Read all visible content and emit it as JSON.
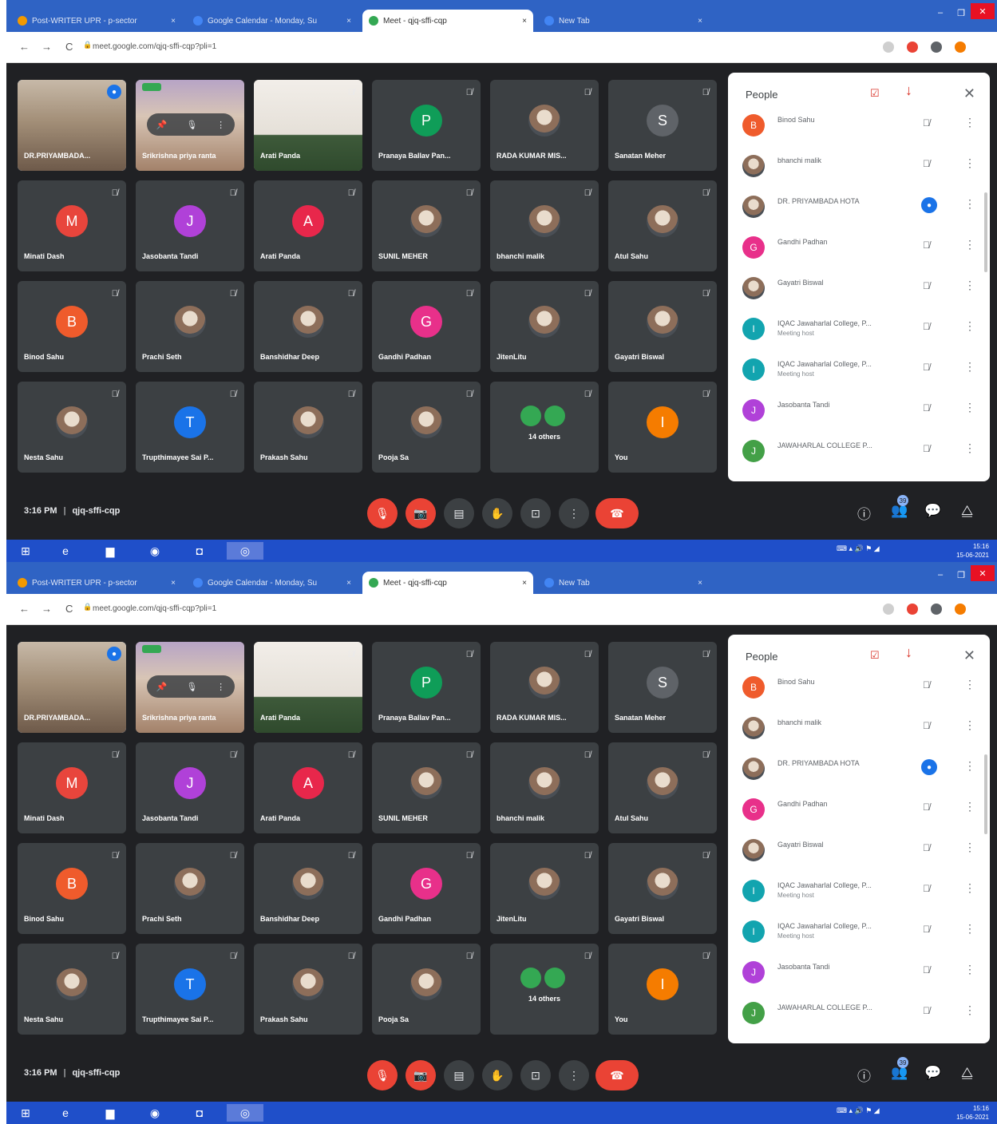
{
  "browser": {
    "tabs": [
      {
        "title": "Post-WRITER UPR - p-sector",
        "fav": "#f29900"
      },
      {
        "title": "Google Calendar - Monday, Su",
        "fav": "#4285f4"
      },
      {
        "title": "Meet - qjq-sffi-cqp",
        "fav": "#34a853"
      },
      {
        "title": "New Tab",
        "fav": "#4285f4"
      }
    ],
    "tab_close_glyph": "×",
    "new_tab_glyph": "+",
    "url": "meet.google.com/qjq-sffi-cqp?pli=1",
    "nav_back": "←",
    "nav_forward": "→",
    "nav_reload": "C",
    "lock": "🔒",
    "win_min": "–",
    "win_max": "❐",
    "win_close": "✕"
  },
  "tiles": [
    {
      "name": "DR.PRIYAMBADA...",
      "type": "video1",
      "selected": true,
      "speaking": true
    },
    {
      "name": "Srikrishna priya ranta",
      "type": "video0",
      "overlay": true
    },
    {
      "name": "Arati Panda",
      "type": "video2"
    },
    {
      "name": "Pranaya Ballav Pan...",
      "initial": "P",
      "color": "#0f9d58"
    },
    {
      "name": "RADA KUMAR MIS...",
      "photo": true
    },
    {
      "name": "Sanatan Meher",
      "initial": "S",
      "color": "#5f6368"
    },
    {
      "name": "Minati Dash",
      "initial": "M",
      "color": "#e8453c"
    },
    {
      "name": "Jasobanta Tandi",
      "initial": "J",
      "color": "#b041d8"
    },
    {
      "name": "Arati Panda",
      "initial": "A",
      "color": "#e8274b"
    },
    {
      "name": "SUNIL MEHER",
      "photo": true
    },
    {
      "name": "bhanchi malik",
      "photo": true
    },
    {
      "name": "Atul Sahu",
      "photo": true
    },
    {
      "name": "Binod Sahu",
      "initial": "B",
      "color": "#ef5b2c"
    },
    {
      "name": "Prachi Seth",
      "photo": true
    },
    {
      "name": "Banshidhar Deep",
      "photo": true
    },
    {
      "name": "Gandhi Padhan",
      "initial": "G",
      "color": "#e8308a"
    },
    {
      "name": "JitenLitu",
      "photo": true
    },
    {
      "name": "Gayatri Biswal",
      "photo": true
    },
    {
      "name": "Nesta Sahu",
      "photo": true
    },
    {
      "name": "Trupthimayee Sai P...",
      "initial": "T",
      "color": "#1a73e8"
    },
    {
      "name": "Prakash Sahu",
      "photo": true
    },
    {
      "name": "Pooja Sa",
      "photo": true
    },
    {
      "name": "14 others",
      "others": true
    },
    {
      "name": "You",
      "initial": "I",
      "color": "#f57c00"
    }
  ],
  "people": {
    "title": "People",
    "close": "✕",
    "manage_glyph": "☑",
    "arrow_glyph": "↓",
    "items": [
      {
        "name": "Binod Sahu",
        "initial": "B",
        "color": "#ef5b2c",
        "status": "mic-off"
      },
      {
        "name": "bhanchi malik",
        "photo": true,
        "status": "mic-off"
      },
      {
        "name": "DR. PRIYAMBADA HOTA",
        "photo": true,
        "status": "speaking"
      },
      {
        "name": "Gandhi Padhan",
        "initial": "G",
        "color": "#e8308a",
        "status": "mic-off"
      },
      {
        "name": "Gayatri Biswal",
        "photo": true,
        "status": "mic-off"
      },
      {
        "name": "IQAC Jawaharlal College, P...",
        "sub": "Meeting host",
        "initial": "I",
        "color": "#12a4af",
        "status": "mic-off"
      },
      {
        "name": "IQAC Jawaharlal College, P...",
        "sub": "Meeting host",
        "initial": "I",
        "color": "#12a4af",
        "status": "mic-off"
      },
      {
        "name": "Jasobanta Tandi",
        "initial": "J",
        "color": "#b041d8",
        "status": "mic-off"
      },
      {
        "name": "JAWAHARLAL COLLEGE P...",
        "initial": "J",
        "color": "#43a047",
        "status": "mic-off"
      }
    ],
    "mic_off_glyph": "🎙̸",
    "more_glyph": "⋮",
    "speaking_glyph": "●"
  },
  "controls": {
    "time": "3:16 PM",
    "separator": "|",
    "meeting_code": "qjq-sffi-cqp",
    "mic_glyph": "🎙",
    "cam_glyph": "📷",
    "cc_glyph": "▤",
    "hand_glyph": "✋",
    "present_glyph": "⊡",
    "more_glyph": "⋮",
    "leave_glyph": "☎",
    "info_glyph": "ⓘ",
    "people_glyph": "👥",
    "people_count": "39",
    "chat_glyph": "💬",
    "activities_glyph": "⧋"
  },
  "taskbar": {
    "start_glyph": "⊞",
    "ie_glyph": "e",
    "explorer_glyph": "▆",
    "firefox_glyph": "◉",
    "app_glyph": "◘",
    "chrome_glyph": "◎",
    "tray_glyph": "⌨  ▴  🔊  ⚑  ◢",
    "clock_time": "15:16",
    "clock_date": "15-06-2021"
  }
}
